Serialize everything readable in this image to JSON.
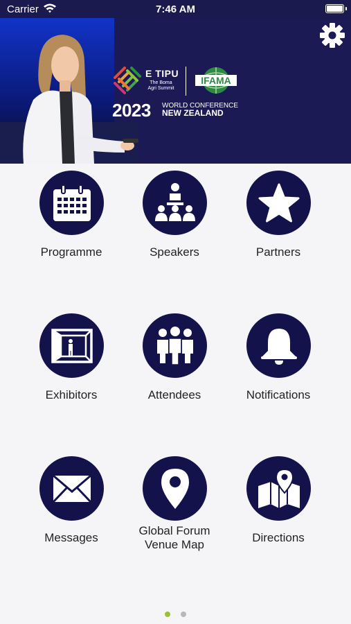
{
  "status_bar": {
    "carrier": "Carrier",
    "time": "7:46 AM"
  },
  "banner": {
    "brand": "E TIPU",
    "brand_sub": "The Boma Agri Summit",
    "partner": "IFAMA",
    "year": "2023",
    "conference": "WORLD CONFERENCE",
    "country": "NEW ZEALAND"
  },
  "menu": [
    {
      "label": "Programme",
      "icon": "calendar-icon"
    },
    {
      "label": "Speakers",
      "icon": "presenter-icon"
    },
    {
      "label": "Partners",
      "icon": "star-icon"
    },
    {
      "label": "Exhibitors",
      "icon": "booth-icon"
    },
    {
      "label": "Attendees",
      "icon": "people-icon"
    },
    {
      "label": "Notifications",
      "icon": "bell-icon"
    },
    {
      "label": "Messages",
      "icon": "envelope-icon"
    },
    {
      "label": "Global Forum Venue Map",
      "icon": "map-pin-icon"
    },
    {
      "label": "Directions",
      "icon": "map-icon"
    }
  ],
  "pager": {
    "pages": 2,
    "current": 1
  },
  "colors": {
    "icon_circle": "#14124a",
    "status_bar": "#1a1a4e",
    "dot_active": "#9bbf3a",
    "dot_inactive": "#b8b8b8"
  }
}
